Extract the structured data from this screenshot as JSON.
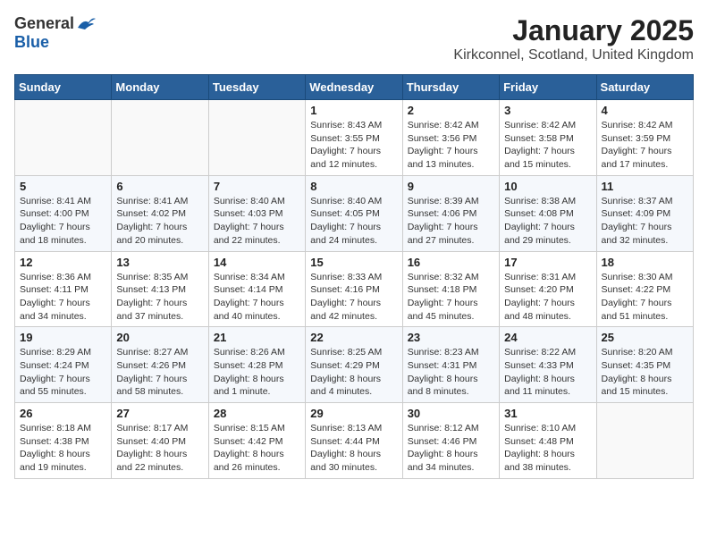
{
  "logo": {
    "general": "General",
    "blue": "Blue"
  },
  "title": "January 2025",
  "location": "Kirkconnel, Scotland, United Kingdom",
  "weekdays": [
    "Sunday",
    "Monday",
    "Tuesday",
    "Wednesday",
    "Thursday",
    "Friday",
    "Saturday"
  ],
  "weeks": [
    [
      {
        "day": "",
        "detail": ""
      },
      {
        "day": "",
        "detail": ""
      },
      {
        "day": "",
        "detail": ""
      },
      {
        "day": "1",
        "detail": "Sunrise: 8:43 AM\nSunset: 3:55 PM\nDaylight: 7 hours\nand 12 minutes."
      },
      {
        "day": "2",
        "detail": "Sunrise: 8:42 AM\nSunset: 3:56 PM\nDaylight: 7 hours\nand 13 minutes."
      },
      {
        "day": "3",
        "detail": "Sunrise: 8:42 AM\nSunset: 3:58 PM\nDaylight: 7 hours\nand 15 minutes."
      },
      {
        "day": "4",
        "detail": "Sunrise: 8:42 AM\nSunset: 3:59 PM\nDaylight: 7 hours\nand 17 minutes."
      }
    ],
    [
      {
        "day": "5",
        "detail": "Sunrise: 8:41 AM\nSunset: 4:00 PM\nDaylight: 7 hours\nand 18 minutes."
      },
      {
        "day": "6",
        "detail": "Sunrise: 8:41 AM\nSunset: 4:02 PM\nDaylight: 7 hours\nand 20 minutes."
      },
      {
        "day": "7",
        "detail": "Sunrise: 8:40 AM\nSunset: 4:03 PM\nDaylight: 7 hours\nand 22 minutes."
      },
      {
        "day": "8",
        "detail": "Sunrise: 8:40 AM\nSunset: 4:05 PM\nDaylight: 7 hours\nand 24 minutes."
      },
      {
        "day": "9",
        "detail": "Sunrise: 8:39 AM\nSunset: 4:06 PM\nDaylight: 7 hours\nand 27 minutes."
      },
      {
        "day": "10",
        "detail": "Sunrise: 8:38 AM\nSunset: 4:08 PM\nDaylight: 7 hours\nand 29 minutes."
      },
      {
        "day": "11",
        "detail": "Sunrise: 8:37 AM\nSunset: 4:09 PM\nDaylight: 7 hours\nand 32 minutes."
      }
    ],
    [
      {
        "day": "12",
        "detail": "Sunrise: 8:36 AM\nSunset: 4:11 PM\nDaylight: 7 hours\nand 34 minutes."
      },
      {
        "day": "13",
        "detail": "Sunrise: 8:35 AM\nSunset: 4:13 PM\nDaylight: 7 hours\nand 37 minutes."
      },
      {
        "day": "14",
        "detail": "Sunrise: 8:34 AM\nSunset: 4:14 PM\nDaylight: 7 hours\nand 40 minutes."
      },
      {
        "day": "15",
        "detail": "Sunrise: 8:33 AM\nSunset: 4:16 PM\nDaylight: 7 hours\nand 42 minutes."
      },
      {
        "day": "16",
        "detail": "Sunrise: 8:32 AM\nSunset: 4:18 PM\nDaylight: 7 hours\nand 45 minutes."
      },
      {
        "day": "17",
        "detail": "Sunrise: 8:31 AM\nSunset: 4:20 PM\nDaylight: 7 hours\nand 48 minutes."
      },
      {
        "day": "18",
        "detail": "Sunrise: 8:30 AM\nSunset: 4:22 PM\nDaylight: 7 hours\nand 51 minutes."
      }
    ],
    [
      {
        "day": "19",
        "detail": "Sunrise: 8:29 AM\nSunset: 4:24 PM\nDaylight: 7 hours\nand 55 minutes."
      },
      {
        "day": "20",
        "detail": "Sunrise: 8:27 AM\nSunset: 4:26 PM\nDaylight: 7 hours\nand 58 minutes."
      },
      {
        "day": "21",
        "detail": "Sunrise: 8:26 AM\nSunset: 4:28 PM\nDaylight: 8 hours\nand 1 minute."
      },
      {
        "day": "22",
        "detail": "Sunrise: 8:25 AM\nSunset: 4:29 PM\nDaylight: 8 hours\nand 4 minutes."
      },
      {
        "day": "23",
        "detail": "Sunrise: 8:23 AM\nSunset: 4:31 PM\nDaylight: 8 hours\nand 8 minutes."
      },
      {
        "day": "24",
        "detail": "Sunrise: 8:22 AM\nSunset: 4:33 PM\nDaylight: 8 hours\nand 11 minutes."
      },
      {
        "day": "25",
        "detail": "Sunrise: 8:20 AM\nSunset: 4:35 PM\nDaylight: 8 hours\nand 15 minutes."
      }
    ],
    [
      {
        "day": "26",
        "detail": "Sunrise: 8:18 AM\nSunset: 4:38 PM\nDaylight: 8 hours\nand 19 minutes."
      },
      {
        "day": "27",
        "detail": "Sunrise: 8:17 AM\nSunset: 4:40 PM\nDaylight: 8 hours\nand 22 minutes."
      },
      {
        "day": "28",
        "detail": "Sunrise: 8:15 AM\nSunset: 4:42 PM\nDaylight: 8 hours\nand 26 minutes."
      },
      {
        "day": "29",
        "detail": "Sunrise: 8:13 AM\nSunset: 4:44 PM\nDaylight: 8 hours\nand 30 minutes."
      },
      {
        "day": "30",
        "detail": "Sunrise: 8:12 AM\nSunset: 4:46 PM\nDaylight: 8 hours\nand 34 minutes."
      },
      {
        "day": "31",
        "detail": "Sunrise: 8:10 AM\nSunset: 4:48 PM\nDaylight: 8 hours\nand 38 minutes."
      },
      {
        "day": "",
        "detail": ""
      }
    ]
  ]
}
